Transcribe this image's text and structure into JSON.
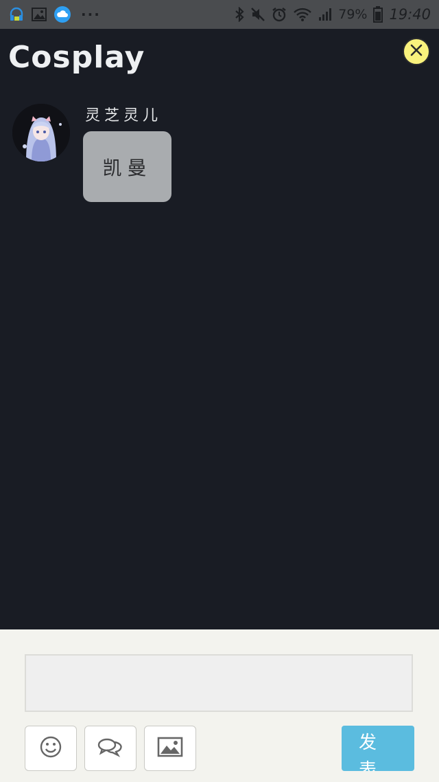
{
  "status_bar": {
    "icons_left": [
      "headset-app-icon",
      "gallery-icon",
      "cloud-icon"
    ],
    "more": "···",
    "icons_right": [
      "bluetooth-icon",
      "mute-icon",
      "alarm-icon",
      "wifi-icon",
      "signal-icon"
    ],
    "battery": "79%",
    "time": "19:40"
  },
  "header": {
    "title": "Cosplay"
  },
  "message": {
    "sender": "灵芝灵儿",
    "text": "凯曼"
  },
  "composer": {
    "input_value": "",
    "tools": [
      "emoji-icon",
      "chat-bubbles-icon",
      "image-icon"
    ],
    "submit_label": "发表"
  },
  "colors": {
    "background": "#191c24",
    "status_bar": "#4a4c4f",
    "close_button": "#f9f27d",
    "bubble": "#a9acaf",
    "composer": "#f3f3ee",
    "submit": "#5bbcdf"
  }
}
